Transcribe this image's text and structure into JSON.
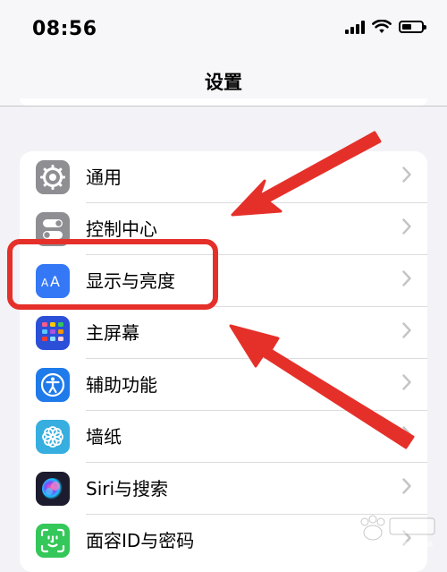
{
  "status_bar": {
    "time": "08:56",
    "battery_level": 0.5,
    "icons": [
      "signal-icon",
      "wifi-icon",
      "battery-icon"
    ]
  },
  "nav": {
    "title": "设置"
  },
  "settings": {
    "rows": [
      {
        "label": "通用",
        "icon": "gear-icon",
        "color": "#8e8e93"
      },
      {
        "label": "控制中心",
        "icon": "toggles-icon",
        "color": "#8e8e93"
      },
      {
        "label": "显示与亮度",
        "icon": "text-size-icon",
        "color": "#3478f6"
      },
      {
        "label": "主屏幕",
        "icon": "home-screen-icon",
        "color": "#2c4fd8"
      },
      {
        "label": "辅助功能",
        "icon": "accessibility-icon",
        "color": "#1f7aea"
      },
      {
        "label": "墙纸",
        "icon": "flower-icon",
        "color": "#36aee0"
      },
      {
        "label": "Siri与搜索",
        "icon": "siri-icon",
        "color": "#1c1c2e"
      },
      {
        "label": "面容ID与密码",
        "icon": "face-id-icon",
        "color": "#34c759"
      }
    ]
  },
  "annotations": {
    "highlight_color": "#e5302a",
    "highlighted_item": "显示与亮度"
  }
}
